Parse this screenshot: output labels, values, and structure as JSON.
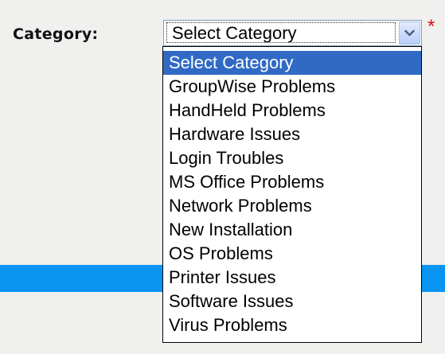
{
  "form": {
    "category_label": "Category:",
    "required_mark": "*",
    "select": {
      "value": "Select Category",
      "dropdown_icon": "chevron-down-icon",
      "highlighted_index": 0,
      "options": [
        "Select Category",
        "GroupWise Problems",
        "HandHeld Problems",
        "Hardware Issues",
        "Login Troubles",
        "MS Office Problems",
        "Network Problems",
        "New Installation",
        "OS Problems",
        "Printer Issues",
        "Software Issues",
        "Virus Problems"
      ]
    }
  },
  "colors": {
    "page_background": "#f0f0ef",
    "highlight": "#316ac5",
    "bar": "#0a94f2",
    "required": "#e01010"
  }
}
